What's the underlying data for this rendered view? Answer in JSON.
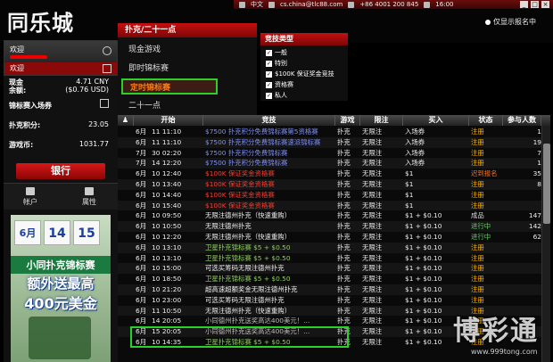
{
  "header": {
    "logo": "同乐城",
    "lang": "中文",
    "email": "cs.china@tlc88.com",
    "phone": "+86 4001 200 845",
    "time": "16:00",
    "only_registered": "仅显示报名中"
  },
  "user": {
    "welcome_title": "欢迎",
    "welcome_bar": "欢迎",
    "cash_label": "现金",
    "cash_value": "4.71 CNY",
    "balance_label": "余额:",
    "balance_value": "($0.76 USD)",
    "tourney_label": "锦标赛入场券",
    "points_label": "扑克积分:",
    "points_value": "23.05",
    "coins_label": "游戏币:",
    "coins_value": "1031.77",
    "bank_button": "银行",
    "account_label": "帐户",
    "options_label": "属性"
  },
  "promo": {
    "d1": "6月",
    "d2": "14",
    "d3": "15",
    "line1": "小同扑克锦标赛",
    "line2": "额外送最高",
    "line3": "400元美金"
  },
  "categories": {
    "header": "扑克/二十一点",
    "items": [
      "现金游戏",
      "即时锦标赛",
      "定时锦标赛",
      "二十一点"
    ]
  },
  "types": {
    "header": "竞技类型",
    "items": [
      "一般",
      "特别",
      "$100K 保证奖金竞技",
      "资格赛",
      "私人"
    ]
  },
  "table": {
    "headers": [
      "",
      "开始",
      "竞技",
      "游戏",
      "限注",
      "买入",
      "状态",
      "参与人数"
    ],
    "rows": [
      {
        "date": "6月",
        "time": "11 11:10",
        "name": "$7500 扑克积分免费锦标赛第5资格赛",
        "game": "扑克",
        "limit": "无限注",
        "buy": "入场券",
        "status": "注册",
        "players": "1",
        "color": "t-blue",
        "st": "status-reg"
      },
      {
        "date": "6月",
        "time": "11 11:10",
        "name": "$7500 扑克积分免费锦标赛速派锦标赛",
        "game": "扑克",
        "limit": "无限注",
        "buy": "入场券",
        "status": "注册",
        "players": "19",
        "color": "t-blue",
        "st": "status-reg"
      },
      {
        "date": "7月",
        "time": "30 02:20",
        "name": "$7500 扑克积分免费锦标赛",
        "game": "扑克",
        "limit": "无限注",
        "buy": "入场券",
        "status": "注册",
        "players": "7",
        "color": "t-blue",
        "st": "status-reg"
      },
      {
        "date": "7月",
        "time": "14 12:20",
        "name": "$7500 扑克积分免费锦标赛",
        "game": "扑克",
        "limit": "无限注",
        "buy": "入场券",
        "status": "注册",
        "players": "1",
        "color": "t-blue",
        "st": "status-reg"
      },
      {
        "date": "6月",
        "time": "10 12:40",
        "name": "$100K 保证奖金资格赛",
        "game": "扑克",
        "limit": "无限注",
        "buy": "$1",
        "status": "迟到报名",
        "players": "35",
        "color": "t-red",
        "st": "status-late"
      },
      {
        "date": "6月",
        "time": "10 13:40",
        "name": "$100K 保证奖金资格赛",
        "game": "扑克",
        "limit": "无限注",
        "buy": "$1",
        "status": "注册",
        "players": "8",
        "color": "t-red",
        "st": "status-reg"
      },
      {
        "date": "6月",
        "time": "10 14:40",
        "name": "$100K 保证奖金资格赛",
        "game": "扑克",
        "limit": "无限注",
        "buy": "$1",
        "status": "注册",
        "players": "",
        "color": "t-red",
        "st": "status-reg"
      },
      {
        "date": "6月",
        "time": "10 15:40",
        "name": "$100K 保证奖金资格赛",
        "game": "扑克",
        "limit": "无限注",
        "buy": "$1",
        "status": "注册",
        "players": "",
        "color": "t-red",
        "st": "status-reg"
      },
      {
        "date": "6月",
        "time": "10 09:50",
        "name": "无限注德州扑克（快速重购）",
        "game": "扑克",
        "limit": "无限注",
        "buy": "$1 + $0.10",
        "status": "成品",
        "players": "147",
        "color": "t-white",
        "st": "status-done"
      },
      {
        "date": "6月",
        "time": "10 10:50",
        "name": "无限注德州扑克",
        "game": "扑克",
        "limit": "无限注",
        "buy": "$1 + $0.10",
        "status": "进行中",
        "players": "142",
        "color": "t-white",
        "st": "status-run"
      },
      {
        "date": "6月",
        "time": "10 12:20",
        "name": "无限注德州扑克（快速重购）",
        "game": "扑克",
        "limit": "无限注",
        "buy": "$1 + $0.10",
        "status": "进行中",
        "players": "62",
        "color": "t-white",
        "st": "status-run"
      },
      {
        "date": "6月",
        "time": "10 13:10",
        "name": "卫星扑克锦标赛 $5 + $0.50",
        "game": "扑克",
        "limit": "无限注",
        "buy": "$1 + $0.10",
        "status": "注册",
        "players": "",
        "color": "t-green",
        "st": "status-reg"
      },
      {
        "date": "6月",
        "time": "10 13:10",
        "name": "卫星扑克锦标赛 $5 + $0.50",
        "game": "扑克",
        "limit": "无限注",
        "buy": "$1 + $0.10",
        "status": "注册",
        "players": "",
        "color": "t-green",
        "st": "status-reg"
      },
      {
        "date": "6月",
        "time": "10 15:00",
        "name": "可选买筹码无限注德州扑克",
        "game": "扑克",
        "limit": "无限注",
        "buy": "$1 + $0.10",
        "status": "注册",
        "players": "",
        "color": "t-white",
        "st": "status-reg"
      },
      {
        "date": "6月",
        "time": "10 18:50",
        "name": "卫星扑克锦标赛 $5 + $0.50",
        "game": "扑克",
        "limit": "无限注",
        "buy": "$1 + $0.10",
        "status": "注册",
        "players": "",
        "color": "t-green",
        "st": "status-reg"
      },
      {
        "date": "6月",
        "time": "10 21:20",
        "name": "超高速超额奖金无限注德州扑克",
        "game": "扑克",
        "limit": "无限注",
        "buy": "$1 + $0.10",
        "status": "注册",
        "players": "",
        "color": "t-white",
        "st": "status-reg"
      },
      {
        "date": "6月",
        "time": "10 23:00",
        "name": "可选买筹码无限注德州扑克",
        "game": "扑克",
        "limit": "无限注",
        "buy": "$1 + $0.10",
        "status": "注册",
        "players": "",
        "color": "t-white",
        "st": "status-reg"
      },
      {
        "date": "6月",
        "time": "11 10:50",
        "name": "无限注德州扑克（快速重购）",
        "game": "扑克",
        "limit": "无限注",
        "buy": "$1 + $0.10",
        "status": "注册",
        "players": "",
        "color": "t-white",
        "st": "status-reg"
      },
      {
        "date": "6月",
        "time": "14 20:05",
        "name": "小同德州扑克送奖高达400美元！...",
        "game": "扑克",
        "limit": "无限注",
        "buy": "$1 + $0.10",
        "status": "注册",
        "players": "",
        "color": "t-gray",
        "st": "status-reg"
      },
      {
        "date": "6月",
        "time": "15 20:05",
        "name": "小同德州扑克送奖高达400美元！...",
        "game": "扑克",
        "limit": "无限注",
        "buy": "$1 + $0.10",
        "status": "注册",
        "players": "",
        "color": "t-gray",
        "st": "status-reg"
      },
      {
        "date": "6月",
        "time": "10 14:35",
        "name": "卫星扑克锦标赛 $5 + $0.50",
        "game": "扑克",
        "limit": "无限注",
        "buy": "$1 + $0.10",
        "status": "注册",
        "players": "",
        "color": "t-green",
        "st": "status-reg"
      }
    ]
  },
  "watermark": {
    "text": "博彩通",
    "url": "www.999tong.com"
  }
}
